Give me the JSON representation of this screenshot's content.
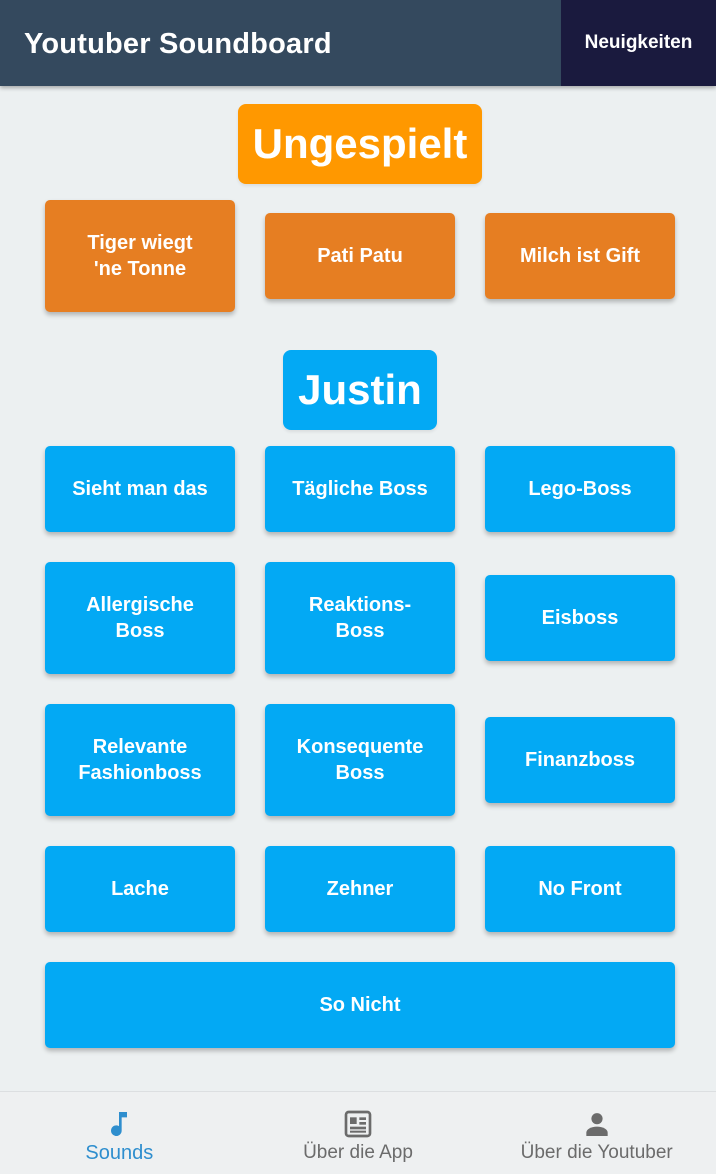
{
  "app_bar": {
    "title": "Youtuber Soundboard",
    "news_label": "Neuigkeiten",
    "bg_color": "#34495e",
    "news_bg_color": "#1a1a3e"
  },
  "sections": {
    "unplayed": {
      "title": "Ungespielt",
      "title_color": "#ff9800",
      "button_color": "#e67e22",
      "buttons": [
        "Tiger wiegt\n'ne Tonne",
        "Pati Patu",
        "Milch ist Gift"
      ]
    },
    "justin": {
      "title": "Justin",
      "title_color": "#03a9f4",
      "button_color": "#03a9f4",
      "buttons": [
        "Sieht man das",
        "Tägliche Boss",
        "Lego-Boss",
        "Allergische\nBoss",
        "Reaktions-\nBoss",
        "Eisboss",
        "Relevante\nFashionboss",
        "Konsequente\nBoss",
        "Finanzboss",
        "Lache",
        "Zehner",
        "No Front",
        "So Nicht"
      ]
    }
  },
  "bottom_nav": {
    "active_color": "#2e8ece",
    "items": [
      {
        "label": "Sounds",
        "icon": "music-note-icon",
        "active": true
      },
      {
        "label": "Über die App",
        "icon": "newspaper-icon",
        "active": false
      },
      {
        "label": "Über die Youtuber",
        "icon": "person-icon",
        "active": false
      }
    ]
  }
}
